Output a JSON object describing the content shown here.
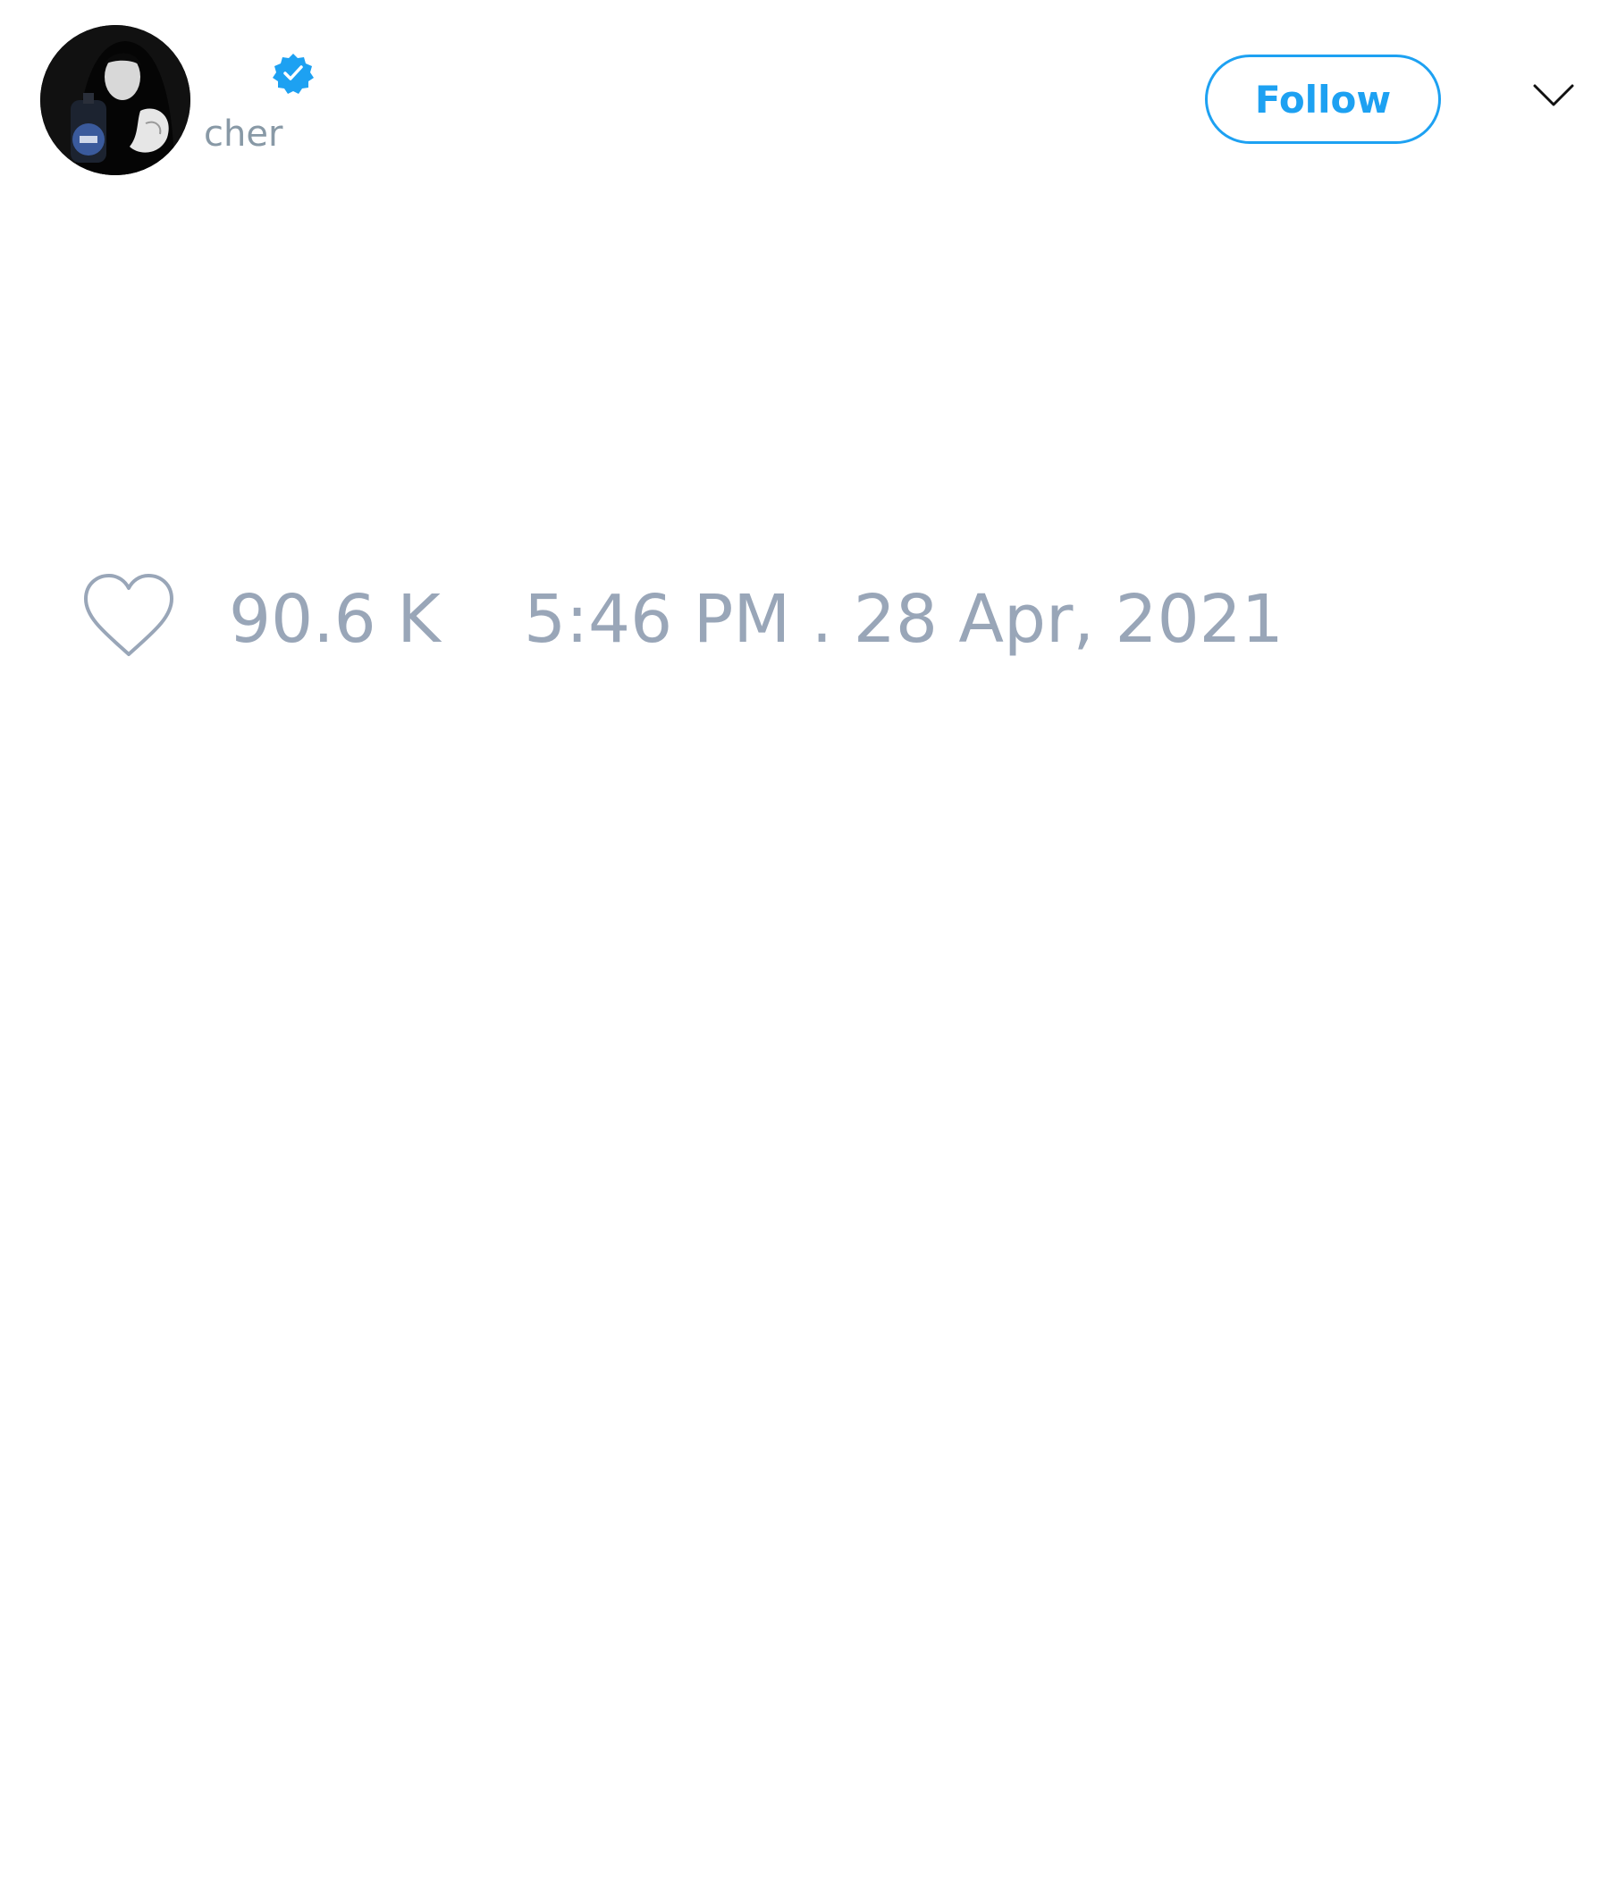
{
  "author": {
    "handle": "cher",
    "verified": true
  },
  "actions": {
    "follow_label": "Follow"
  },
  "stats": {
    "like_count": "90.6 K",
    "timestamp": "5:46 PM . 28 Apr, 2021"
  },
  "icons": {
    "verified": "verified-badge-icon",
    "menu": "chevron-down-icon",
    "like": "heart-outline-icon"
  },
  "colors": {
    "accent": "#1da1f2",
    "muted_text": "#99a6b8",
    "handle_text": "#8899a6"
  }
}
